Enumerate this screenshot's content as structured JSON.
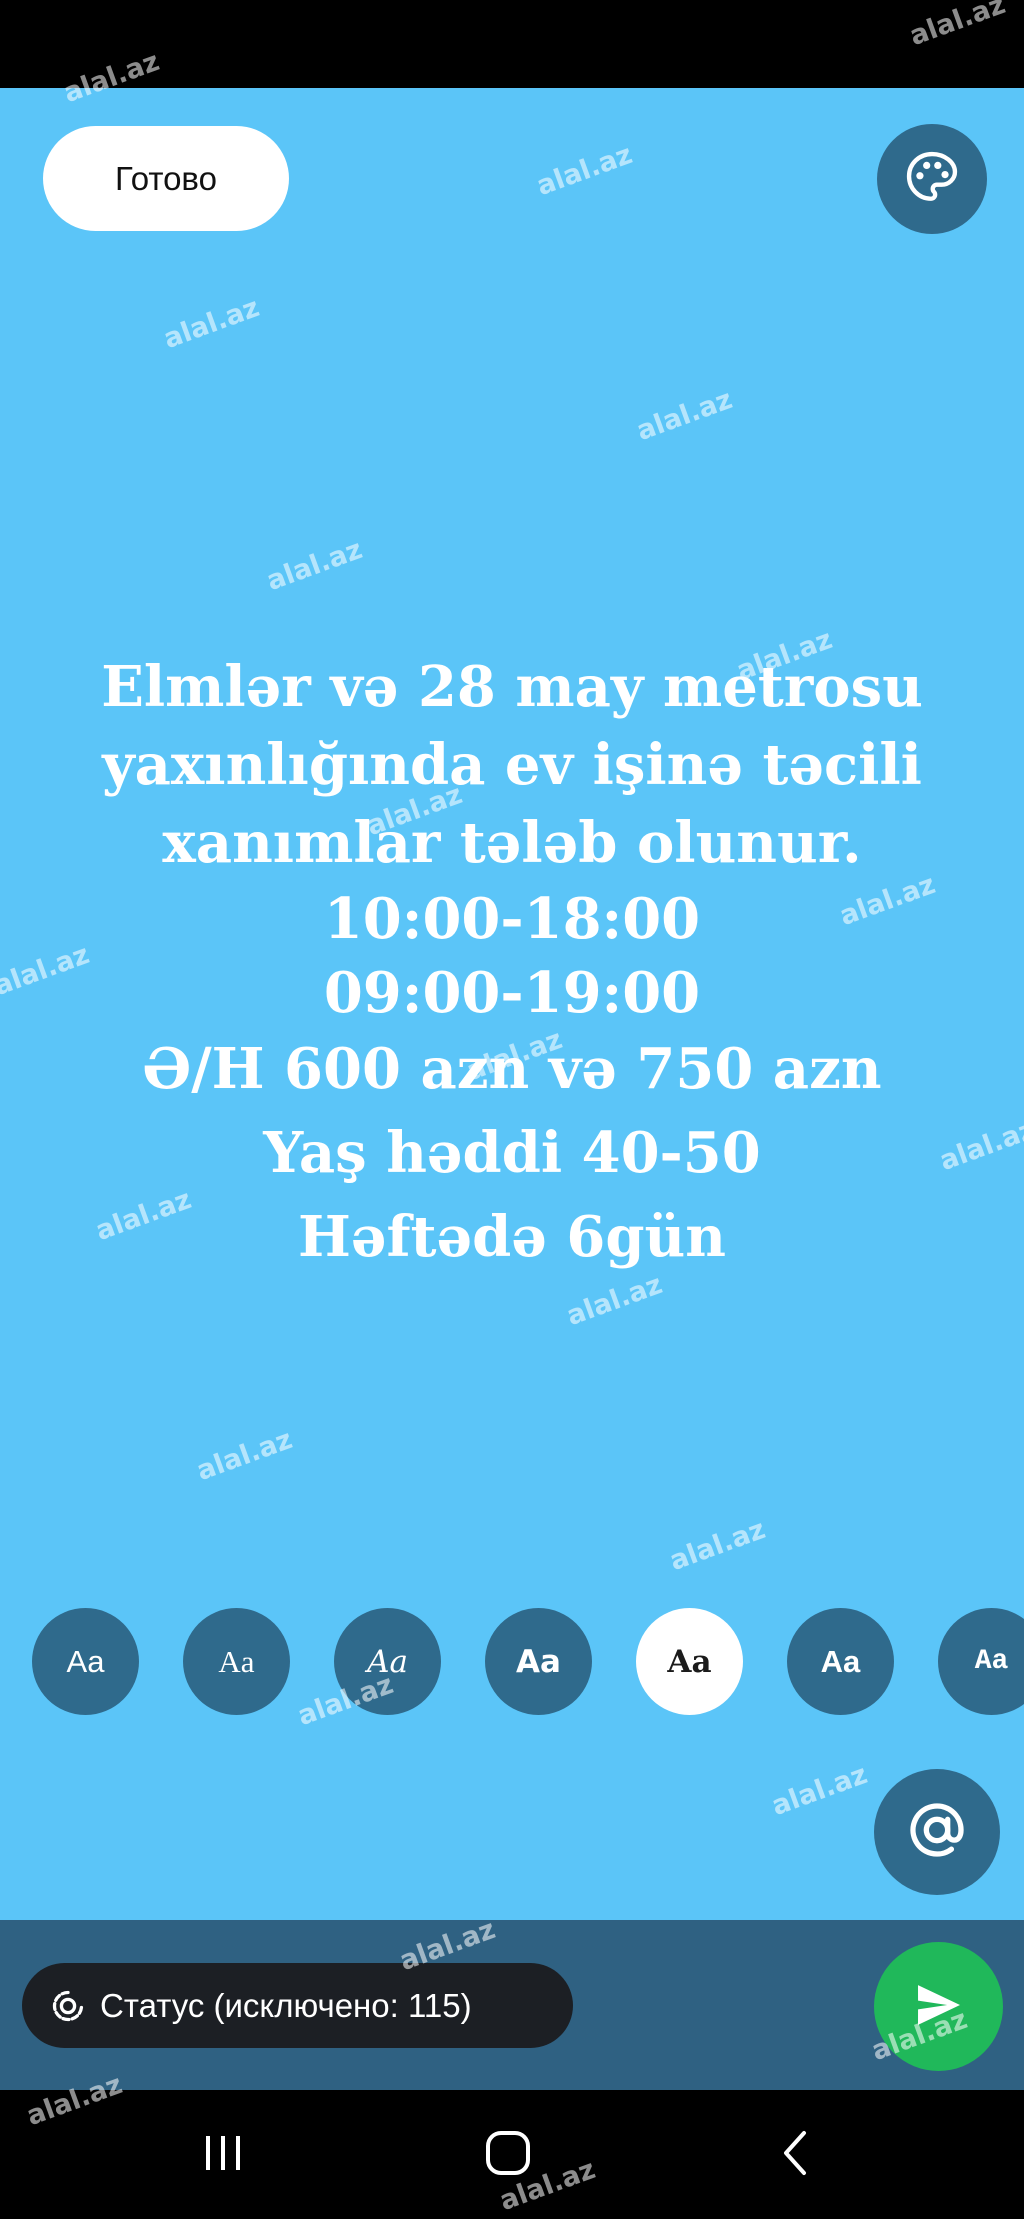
{
  "toolbar": {
    "done_label": "Готово"
  },
  "post": {
    "lines": [
      "Elmlər və 28 may metrosu",
      "yaxınlığında ev işinə təcili",
      "xanımlar tələb olunur.",
      "10:00-18:00",
      "09:00-19:00",
      "Ə/H 600 azn və 750 azn",
      "Yaş həddi 40-50",
      "Həftədə 6gün"
    ]
  },
  "font_options": {
    "label": "Aa",
    "selected_index": 4
  },
  "status_selector": {
    "label": "Статус (исключено: 115)"
  },
  "watermark": "alal.az",
  "colors": {
    "canvas_bg": "#5bc5f8",
    "button_bg": "#2f6a8c",
    "bottom_bar": "#2f6182",
    "send_green": "#20b85a"
  },
  "icons": [
    "palette-icon",
    "at-sign-icon",
    "status-ring-icon",
    "send-icon",
    "recents-icon",
    "home-icon",
    "back-icon"
  ]
}
